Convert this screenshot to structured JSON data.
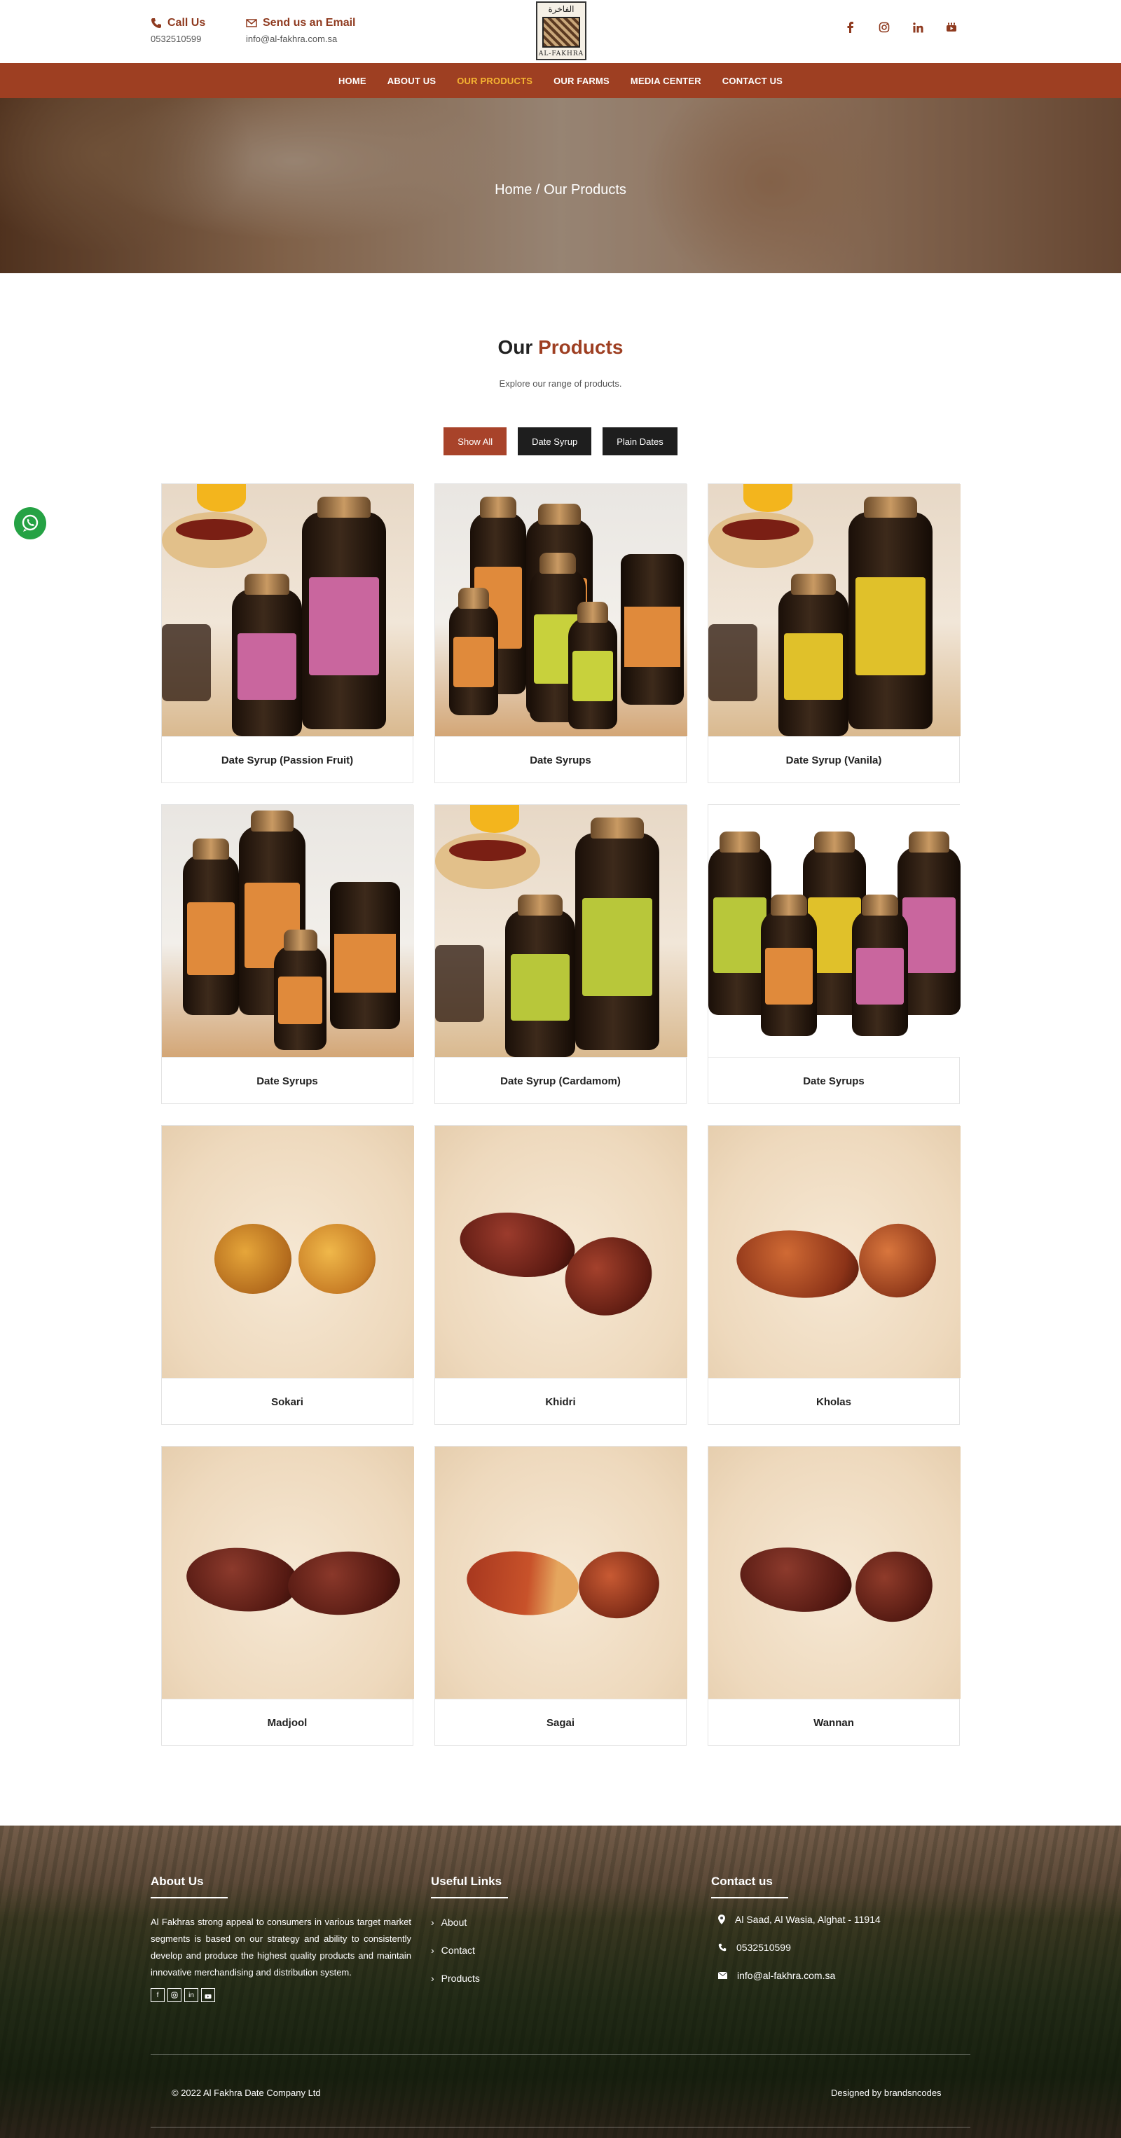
{
  "header": {
    "call_title": "Call Us",
    "call_value": "0532510599",
    "email_title": "Send us an Email",
    "email_value": "info@al-fakhra.com.sa",
    "logo_ar": "الفاخرة",
    "logo_en": "AL-FAKHRA",
    "socials": [
      "facebook-icon",
      "instagram-icon",
      "linkedin-icon",
      "youtube-icon"
    ]
  },
  "nav": {
    "items": [
      {
        "label": "HOME"
      },
      {
        "label": "ABOUT US"
      },
      {
        "label": "OUR PRODUCTS",
        "active": true
      },
      {
        "label": "OUR FARMS"
      },
      {
        "label": "MEDIA CENTER"
      },
      {
        "label": "CONTACT US"
      }
    ]
  },
  "hero": {
    "breadcrumb": "Home / Our Products"
  },
  "section": {
    "title_plain": "Our",
    "title_accent": "Products",
    "subtitle": "Explore our range of products."
  },
  "filters": [
    {
      "label": "Show All",
      "active": true
    },
    {
      "label": "Date Syrup"
    },
    {
      "label": "Plain Dates"
    }
  ],
  "products": [
    {
      "name": "Date Syrup (Passion Fruit)"
    },
    {
      "name": "Date Syrups"
    },
    {
      "name": "Date Syrup (Vanila)"
    },
    {
      "name": "Date Syrups"
    },
    {
      "name": "Date Syrup (Cardamom)"
    },
    {
      "name": "Date Syrups"
    },
    {
      "name": "Sokari"
    },
    {
      "name": "Khidri"
    },
    {
      "name": "Kholas"
    },
    {
      "name": "Madjool"
    },
    {
      "name": "Sagai"
    },
    {
      "name": "Wannan"
    }
  ],
  "footer": {
    "about_title": "About Us",
    "about_text": "Al Fakhras strong appeal to consumers in various target market segments is based on our strategy and ability to consistently develop and produce the highest quality products and maintain innovative merchandising and distribution system.",
    "links_title": "Useful Links",
    "links": [
      "About",
      "Contact",
      "Products"
    ],
    "contact_title": "Contact us",
    "address": "Al Saad, Al Wasia, Alghat - 11914",
    "phone": "0532510599",
    "email": "info@al-fakhra.com.sa",
    "copyright": "© 2022 Al Fakhra Date Company Ltd",
    "designed_by": "Designed by brandsncodes"
  },
  "colors": {
    "brand": "#9e3f22",
    "nav_active": "#f5b432",
    "filter_active": "#a8432a",
    "filter_default": "#1e1e1e",
    "whatsapp": "#25a244"
  }
}
